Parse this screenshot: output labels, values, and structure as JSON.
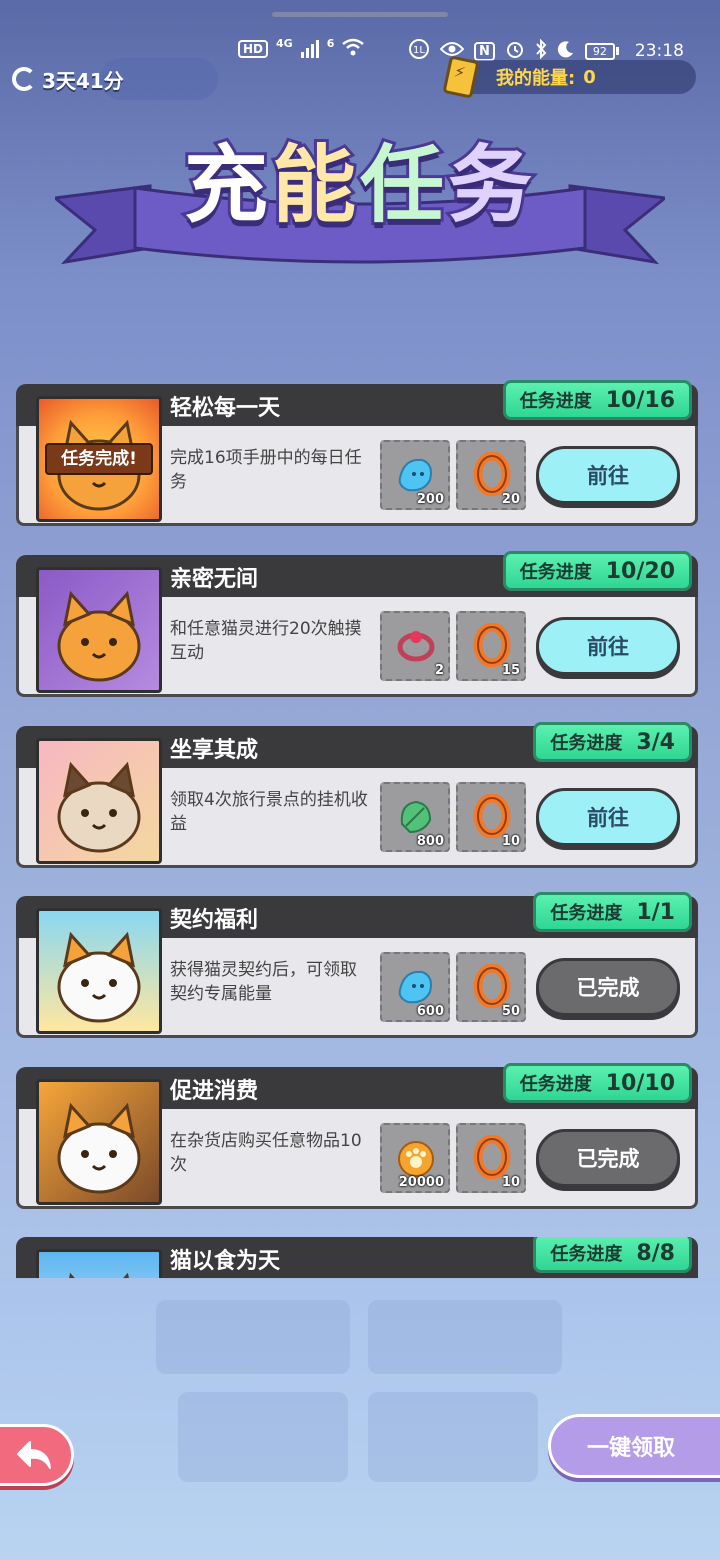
{
  "status_bar": {
    "hd": "HD",
    "network": "4G",
    "wifi_badge": "6",
    "nfc": "N",
    "battery": "92",
    "time": "23:18"
  },
  "header": {
    "timer": "3天41分",
    "energy_label": "我的能量:",
    "energy_value": "0"
  },
  "banner": {
    "title": [
      "充",
      "能",
      "任",
      "务"
    ],
    "title_colors": [
      "#ffffff",
      "#ffffff",
      "#ffffff",
      "#ffffff"
    ],
    "rainbow": [
      "#ff6b6b",
      "#ffd93b",
      "#6ee07a",
      "#5ab8ff",
      "#b57bff"
    ]
  },
  "tasks": [
    {
      "title": "轻松每一天",
      "desc": "完成16项手册中的每日任务",
      "progress_label": "任务进度",
      "progress": "10/16",
      "rewards": [
        {
          "icon": "blue-crystal-icon",
          "qty": "200"
        },
        {
          "icon": "orange-ring-icon",
          "qty": "20"
        }
      ],
      "button": "前往",
      "state": "go",
      "thumb_badge": "任务完成!"
    },
    {
      "title": "亲密无间",
      "desc": "和任意猫灵进行20次触摸互动",
      "progress_label": "任务进度",
      "progress": "10/20",
      "rewards": [
        {
          "icon": "bell-collar-icon",
          "qty": "2"
        },
        {
          "icon": "orange-ring-icon",
          "qty": "15"
        }
      ],
      "button": "前往",
      "state": "go"
    },
    {
      "title": "坐享其成",
      "desc": "领取4次旅行景点的挂机收益",
      "progress_label": "任务进度",
      "progress": "3/4",
      "rewards": [
        {
          "icon": "green-leaf-icon",
          "qty": "800"
        },
        {
          "icon": "orange-ring-icon",
          "qty": "10"
        }
      ],
      "button": "前往",
      "state": "go"
    },
    {
      "title": "契约福利",
      "desc": "获得猫灵契约后，可领取契约专属能量",
      "progress_label": "任务进度",
      "progress": "1/1",
      "rewards": [
        {
          "icon": "blue-crystal-icon",
          "qty": "600"
        },
        {
          "icon": "orange-ring-icon",
          "qty": "50"
        }
      ],
      "button": "已完成",
      "state": "done"
    },
    {
      "title": "促进消费",
      "desc": "在杂货店购买任意物品10次",
      "progress_label": "任务进度",
      "progress": "10/10",
      "rewards": [
        {
          "icon": "paw-coin-icon",
          "qty": "20000"
        },
        {
          "icon": "orange-ring-icon",
          "qty": "10"
        }
      ],
      "button": "已完成",
      "state": "done"
    },
    {
      "title": "猫以食为天",
      "desc": "",
      "progress_label": "任务进度",
      "progress": "8/8",
      "rewards": [],
      "button": "",
      "state": "done"
    }
  ],
  "footer": {
    "claim_all": "一键领取"
  }
}
